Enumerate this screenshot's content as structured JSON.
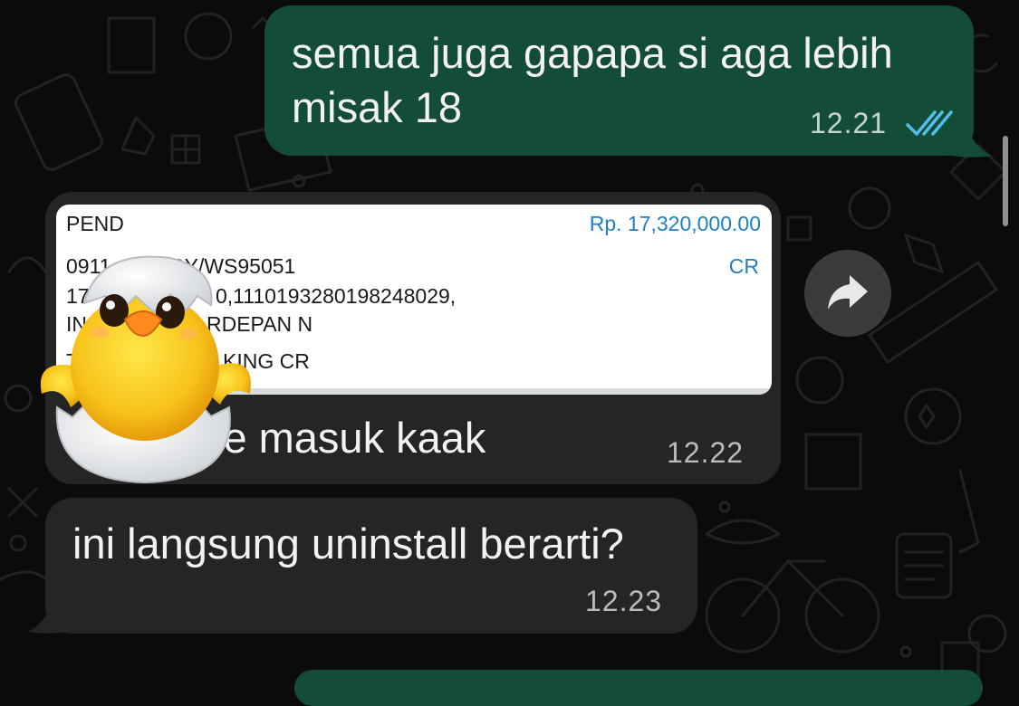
{
  "messages": [
    {
      "direction": "outgoing",
      "text_line1": "semua juga gapapa si aga lebih",
      "text_line2": "misak 18",
      "time": "12.21",
      "status": "read"
    },
    {
      "direction": "incoming",
      "receipt": {
        "label": "PEND",
        "amount": "Rp. 17,320,000.00",
        "line1": "0911",
        "line1b": "CY/WS95051",
        "line1_flag": "CR",
        "line2": "17",
        "line2b": "0,1110193280198248029,",
        "line3": "IN",
        "line3b": "RDEPAN N",
        "line4": "T",
        "line4b": "KING CR"
      },
      "text": "ie masuk kaak",
      "time": "12.22"
    },
    {
      "direction": "incoming",
      "text": "ini langsung uninstall berarti?",
      "time": "12.23"
    }
  ],
  "colors": {
    "outgoing_bubble": "#144d37",
    "incoming_bubble": "#242626",
    "read_ticks": "#53bdeb",
    "amount_blue": "#1f7fc1"
  },
  "icons": {
    "forward": "forward-arrow-icon",
    "read": "double-check-icon",
    "sticker": "hatching-chick-sticker"
  }
}
